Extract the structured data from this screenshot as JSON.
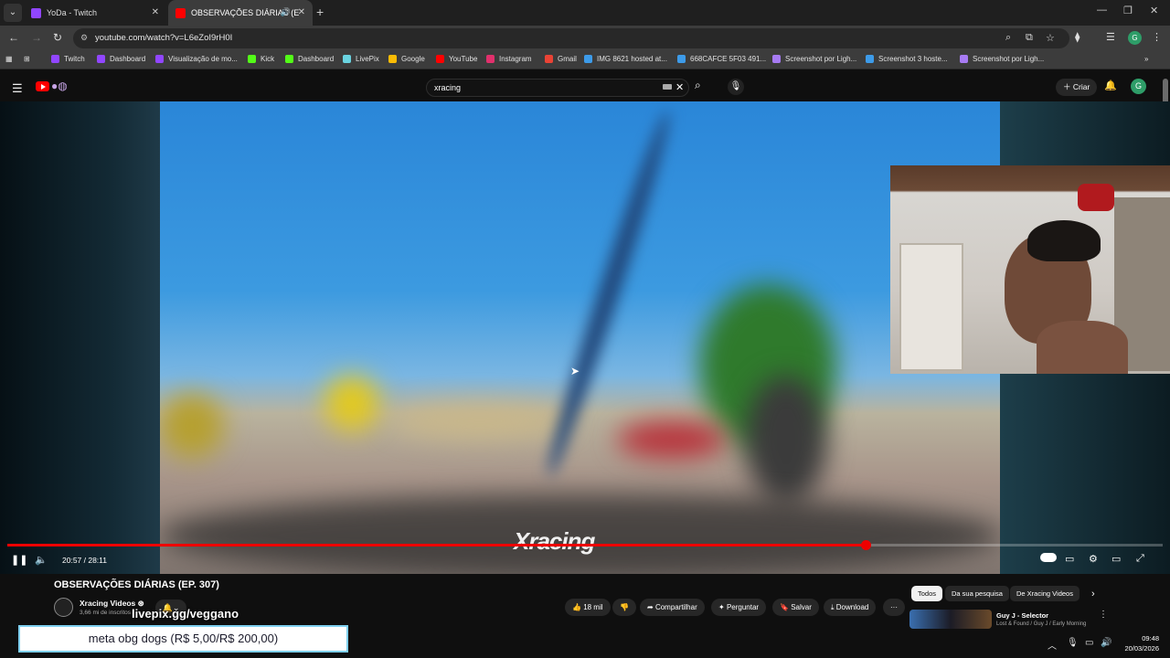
{
  "browser": {
    "tabs": [
      {
        "label": "YoDa - Twitch",
        "color": "#9146ff"
      },
      {
        "label": "OBSERVAÇÕES DIÁRIAS (E",
        "color": "#ff0000"
      }
    ],
    "url": "youtube.com/watch?v=L6eZoI9rH0I",
    "profile_letter": "G",
    "bookmarks": [
      {
        "label": "Twitch",
        "color": "#9146ff"
      },
      {
        "label": "Dashboard",
        "color": "#9146ff"
      },
      {
        "label": "Visualização de mo...",
        "color": "#9146ff"
      },
      {
        "label": "Kick",
        "color": "#53fc18"
      },
      {
        "label": "Dashboard",
        "color": "#53fc18"
      },
      {
        "label": "LivePix",
        "color": "#6ad3e0"
      },
      {
        "label": "Google",
        "color": "#fbbc05"
      },
      {
        "label": "YouTube",
        "color": "#ff0000"
      },
      {
        "label": "Instagram",
        "color": "#e1306c"
      },
      {
        "label": "Gmail",
        "color": "#ea4335"
      },
      {
        "label": "IMG 8621 hosted at...",
        "color": "#3d9be9"
      },
      {
        "label": "668CAFCE 5F03 491...",
        "color": "#3d9be9"
      },
      {
        "label": "Screenshot por Ligh...",
        "color": "#a77bf3"
      },
      {
        "label": "Screenshot 3 hoste...",
        "color": "#3d9be9"
      },
      {
        "label": "Screenshot por Ligh...",
        "color": "#a77bf3"
      }
    ],
    "overflow": "»"
  },
  "youtube": {
    "search_value": "xracing",
    "create_label": "Criar",
    "avatar_letter": "G"
  },
  "player": {
    "time": "20:57 / 28:11",
    "progress": 0.743,
    "watermark": "Xracing"
  },
  "video": {
    "title": "OBSERVAÇÕES DIÁRIAS (EP. 307)",
    "channel": "Xracing Videos ⊛",
    "subscribers": "3,66 mi de inscritos",
    "likes": "18 mil",
    "share": "Compartilhar",
    "ask": "Perguntar",
    "save": "Salvar",
    "download": "Download",
    "more": "···"
  },
  "chips": [
    "Todos",
    "Da sua pesquisa",
    "De Xracing Videos"
  ],
  "recommendation": {
    "title": "Guy J - Selector",
    "subtitle": "Lost & Found / Guy J / Early Morning"
  },
  "stream_overlay": {
    "livepix": "livepix.gg/veggano",
    "goal": "meta obg dogs (R$ 5,00/R$ 200,00)"
  },
  "taskbar": {
    "time": "09:48",
    "date": "20/03/2026"
  }
}
